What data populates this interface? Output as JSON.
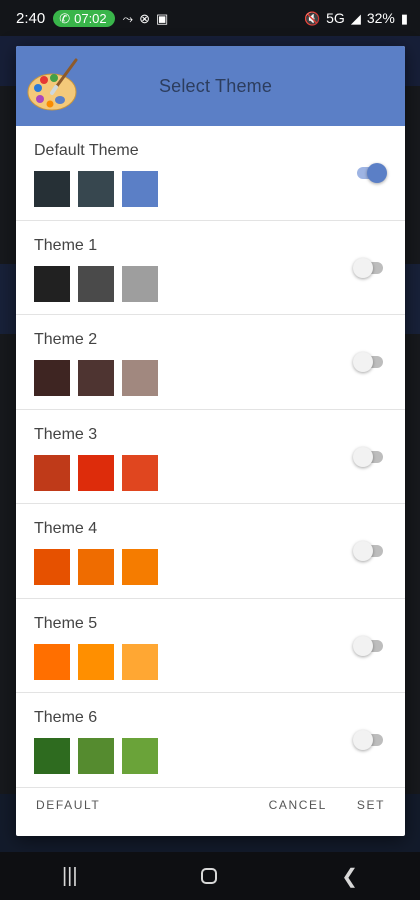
{
  "status_bar": {
    "time": "2:40",
    "call_duration": "07:02",
    "network": "5G",
    "battery": "32%",
    "icons_left": [
      "phone-icon",
      "missed-call-icon",
      "xbox-icon",
      "image-icon"
    ],
    "icons_right": [
      "mute-icon",
      "signal-icon",
      "battery-icon"
    ]
  },
  "dialog": {
    "title": "Select Theme",
    "themes": [
      {
        "label": "Default Theme",
        "enabled": true,
        "colors": [
          "#263036",
          "#37474f",
          "#5b7fc6"
        ]
      },
      {
        "label": "Theme 1",
        "enabled": false,
        "colors": [
          "#212121",
          "#4a4a4a",
          "#9e9e9e"
        ]
      },
      {
        "label": "Theme 2",
        "enabled": false,
        "colors": [
          "#3e2522",
          "#4e3431",
          "#a1887f"
        ]
      },
      {
        "label": "Theme 3",
        "enabled": false,
        "colors": [
          "#bf3a19",
          "#dd2c0b",
          "#e0461f"
        ]
      },
      {
        "label": "Theme 4",
        "enabled": false,
        "colors": [
          "#e65100",
          "#ef6c00",
          "#f57c00"
        ]
      },
      {
        "label": "Theme 5",
        "enabled": false,
        "colors": [
          "#ff6f00",
          "#ff8f00",
          "#ffa733"
        ]
      },
      {
        "label": "Theme 6",
        "enabled": false,
        "colors": [
          "#2e6b1f",
          "#558b2f",
          "#6aa339"
        ]
      }
    ],
    "actions": {
      "default_label": "DEFAULT",
      "cancel_label": "CANCEL",
      "set_label": "SET"
    }
  },
  "colors": {
    "header": "#5b7fc6",
    "accent": "#5b7fc6"
  }
}
